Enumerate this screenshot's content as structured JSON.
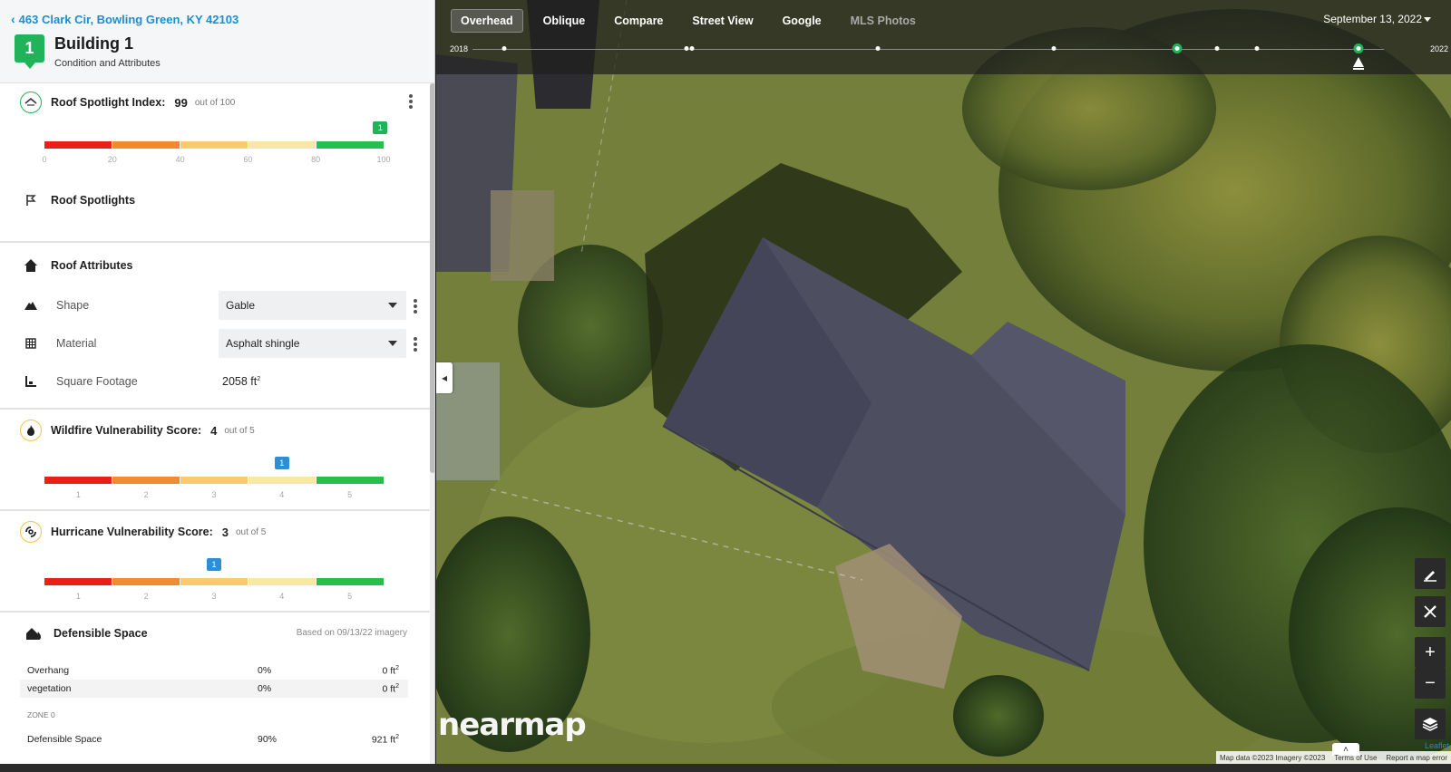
{
  "header": {
    "back_label": "463 Clark Cir, Bowling Green, KY 42103",
    "badge": "1",
    "title": "Building 1",
    "subtitle": "Condition and Attributes"
  },
  "roof_spotlight": {
    "title": "Roof Spotlight Index:",
    "value": "99",
    "outof": "out of 100",
    "score": 99,
    "scale_max": 100,
    "ticks": [
      "0",
      "20",
      "40",
      "60",
      "80",
      "100"
    ],
    "marker_label": "1",
    "spotlights_label": "Roof Spotlights"
  },
  "roof_attributes": {
    "title": "Roof Attributes",
    "shape_label": "Shape",
    "shape_value": "Gable",
    "material_label": "Material",
    "material_value": "Asphalt shingle",
    "sqft_label": "Square Footage",
    "sqft_value": "2058 ft",
    "sqft_unit_sup": "2"
  },
  "wildfire": {
    "title": "Wildfire Vulnerability Score:",
    "value": "4",
    "outof": "out of 5",
    "score": 4,
    "ticks": [
      "1",
      "2",
      "3",
      "4",
      "5"
    ],
    "marker_label": "1"
  },
  "hurricane": {
    "title": "Hurricane Vulnerability Score:",
    "value": "3",
    "outof": "out of 5",
    "score": 3,
    "ticks": [
      "1",
      "2",
      "3",
      "4",
      "5"
    ],
    "marker_label": "1"
  },
  "defensible": {
    "title": "Defensible Space",
    "note": "Based on 09/13/22 imagery",
    "rows": [
      {
        "name": "Overhang",
        "pct": "0%",
        "area": "0 ft",
        "sup": "2"
      },
      {
        "name": "vegetation",
        "pct": "0%",
        "area": "0 ft",
        "sup": "2"
      }
    ],
    "zone_label": "ZONE 0",
    "row3": {
      "name": "Defensible Space",
      "pct": "90%",
      "area": "921 ft",
      "sup": "2"
    }
  },
  "map": {
    "tabs": [
      "Overhead",
      "Oblique",
      "Compare",
      "Street View",
      "Google",
      "MLS Photos"
    ],
    "date": "September 13, 2022",
    "timeline_start": "2018",
    "timeline_end": "2022",
    "logo": "nearmap",
    "attribution_data": "Map data ©2023 Imagery ©2023",
    "attribution_terms": "Terms of Use",
    "attribution_report": "Report a map error",
    "leaflet": "Leaflet"
  },
  "colors": {
    "scale": [
      "#e8201c",
      "#f28a2e",
      "#f7cc6c",
      "#f8e7a6",
      "#23c050"
    ],
    "accent_green": "#20b35a",
    "accent_blue": "#2a8fd6",
    "link": "#1a8fd6"
  }
}
